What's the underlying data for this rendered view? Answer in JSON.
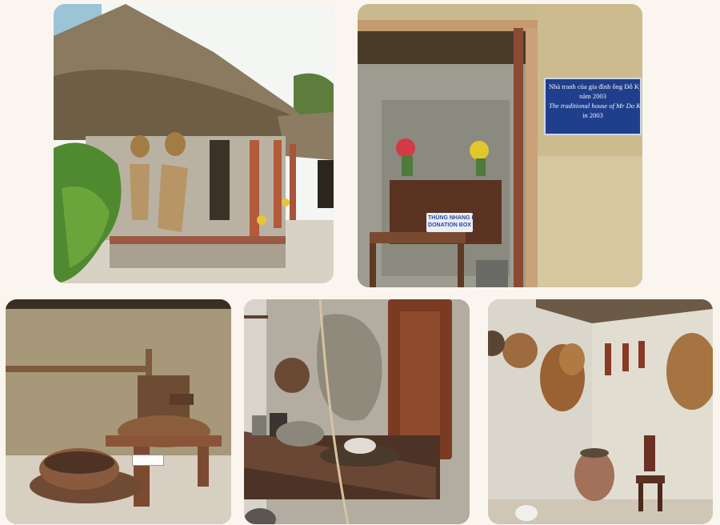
{
  "photos": [
    {
      "subject": "Thatched-roof traditional house exterior with hanging baskets"
    },
    {
      "subject": "Doorway with altar and informational plaque"
    },
    {
      "subject": "Wooden rice mill on woven bamboo wall"
    },
    {
      "subject": "Kitchen shelf with pots, wooden board and basket"
    },
    {
      "subject": "Corner with hanging baskets and clay jar"
    }
  ],
  "plaque": {
    "line1": "Nhà tranh của gia đình ông Đỗ Kỳ được phục",
    "line2": "năm 2003",
    "line3": "The traditional house of Mr Do Ky's family was re",
    "line4": "in 2003"
  },
  "donation_box": {
    "line1": "THÙNG NHANG KHÓI",
    "line2": "DONATION BOX"
  },
  "colors": {
    "page_background": "#fbf5ef",
    "plaque_blue": "#1f3f8c"
  }
}
